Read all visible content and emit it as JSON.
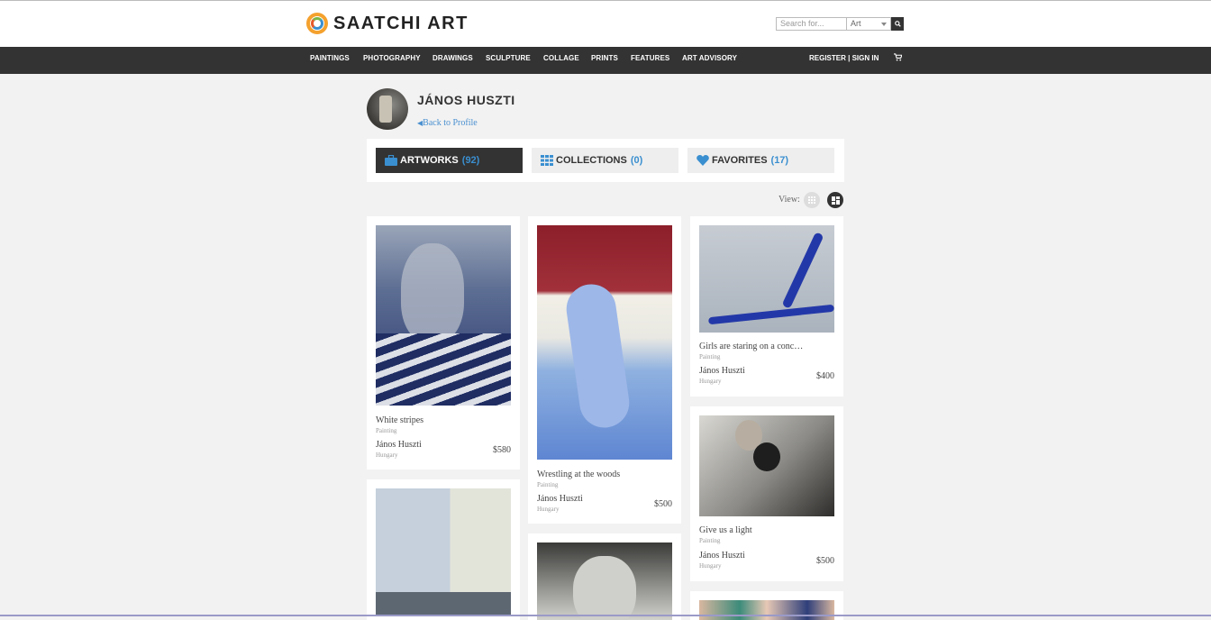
{
  "header": {
    "logo_text": "SAATCHI ART",
    "search_placeholder": "Search for...",
    "search_scope": "Art"
  },
  "nav": {
    "items": [
      "PAINTINGS",
      "PHOTOGRAPHY",
      "DRAWINGS",
      "SCULPTURE",
      "COLLAGE",
      "PRINTS",
      "FEATURES",
      "ART ADVISORY"
    ],
    "account": "REGISTER | SIGN IN"
  },
  "profile": {
    "name": "JÁNOS HUSZTI",
    "back_link": "Back to Profile"
  },
  "tabs": [
    {
      "label": "ARTWORKS",
      "count": "(92)"
    },
    {
      "label": "COLLECTIONS",
      "count": "(0)"
    },
    {
      "label": "FAVORITES",
      "count": "(17)"
    }
  ],
  "view_label": "View:",
  "artworks": [
    {
      "title": "White stripes",
      "type": "Painting",
      "artist": "János Huszti",
      "country": "Hungary",
      "price": "$580"
    },
    {
      "title": "Wrestling at the woods",
      "type": "Painting",
      "artist": "János Huszti",
      "country": "Hungary",
      "price": "$500"
    },
    {
      "title": "Girls are staring on a conc…",
      "type": "Painting",
      "artist": "János Huszti",
      "country": "Hungary",
      "price": "$400"
    },
    {
      "title": "Give us a light",
      "type": "Painting",
      "artist": "János Huszti",
      "country": "Hungary",
      "price": "$500"
    }
  ],
  "colors": {
    "accent": "#3a8fd0",
    "navbar": "#333333",
    "background": "#f2f2f2"
  }
}
